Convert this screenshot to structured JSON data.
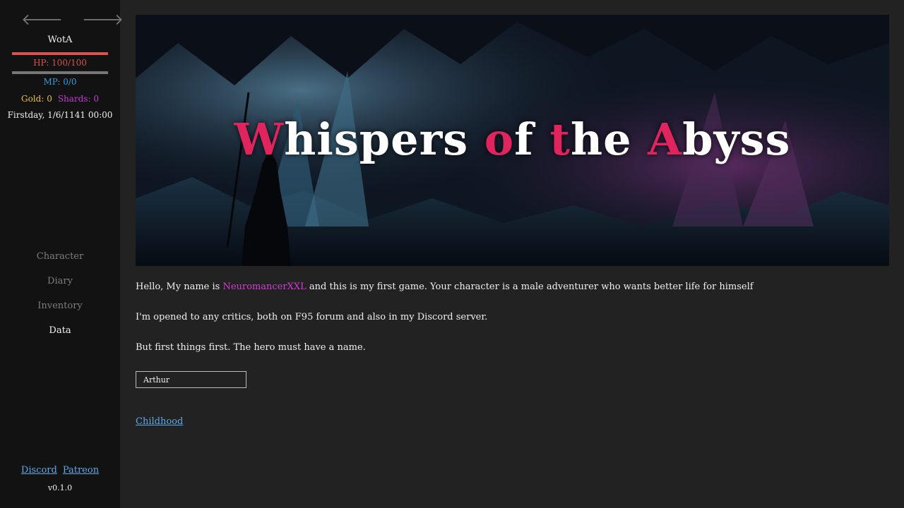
{
  "sidebar": {
    "back_icon": "arrow-left-icon",
    "forward_icon": "arrow-right-icon",
    "back_glyph": "🡐",
    "forward_glyph": "🡒",
    "story_title": "WotA",
    "hp": {
      "text": "HP: 100/100",
      "current": 100,
      "max": 100,
      "color": "#d9534f"
    },
    "mp": {
      "text": "MP: 0/0",
      "current": 0,
      "max": 0,
      "color": "#3a9ad9"
    },
    "gold": "Gold: 0",
    "shards": "Shards: 0",
    "date": "Firstday, 1/6/1141 00:00",
    "menu": [
      {
        "label": "Character"
      },
      {
        "label": "Diary"
      },
      {
        "label": "Inventory"
      },
      {
        "label": "Data"
      }
    ],
    "links": {
      "discord": "Discord",
      "patreon": "Patreon"
    },
    "version": "v0.1.0"
  },
  "main": {
    "banner": {
      "title_parts": [
        "W",
        "hispers ",
        "o",
        "f ",
        "t",
        "he ",
        "A",
        "byss"
      ],
      "accent_color": "#e0245e"
    },
    "intro": {
      "before": "Hello, My name is ",
      "author": "NeuromancerXXL",
      "after": " and this is my first game. Your character is a male adventurer who wants better life for himself"
    },
    "critics": "I'm opened to any critics, both on F95 forum and also in my Discord server.",
    "name_prompt": "But first things first. The hero must have a name.",
    "name_input": {
      "value": "Arthur"
    },
    "continue_link": "Childhood"
  }
}
